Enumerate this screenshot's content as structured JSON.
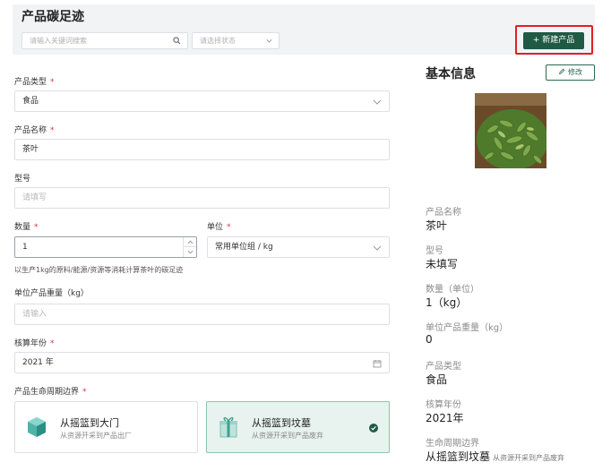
{
  "header": {
    "title": "产品碳足迹",
    "search_placeholder": "请输入关键词搜索",
    "status_placeholder": "请选择状态",
    "new_button": "+ 新建产品"
  },
  "form": {
    "product_type": {
      "label": "产品类型",
      "value": "食品"
    },
    "product_name": {
      "label": "产品名称",
      "value": "茶叶"
    },
    "model": {
      "label": "型号",
      "placeholder": "请填写"
    },
    "quantity": {
      "label": "数量",
      "value": "1"
    },
    "unit": {
      "label": "单位",
      "value": "常用单位组 / kg"
    },
    "hint": "以生产1kg的原料/能源/资源等消耗计算茶叶的碳足迹",
    "unit_weight": {
      "label": "单位产品重量（kg）",
      "placeholder": "请输入"
    },
    "year": {
      "label": "核算年份",
      "value": "2021 年"
    },
    "lifecycle": {
      "label": "产品生命周期边界",
      "options": [
        {
          "title": "从摇篮到大门",
          "subtitle": "从资源开采到产品出厂",
          "selected": false
        },
        {
          "title": "从摇篮到坟墓",
          "subtitle": "从资源开采到产品废弃",
          "selected": true
        }
      ]
    }
  },
  "info": {
    "title": "基本信息",
    "edit_button": "修改",
    "name_label": "产品名称",
    "name_value": "茶叶",
    "model_label": "型号",
    "model_value": "未填写",
    "quantity_label": "数量（单位）",
    "quantity_value": "1（kg）",
    "weight_label": "单位产品重量（kg）",
    "weight_value": "0",
    "type_label": "产品类型",
    "type_value": "食品",
    "year_label": "核算年份",
    "year_value": "2021年",
    "lifecycle_label": "生命周期边界",
    "lifecycle_value": "从摇篮到坟墓",
    "lifecycle_sub": "从资源开采到产品废弃"
  },
  "colors": {
    "primary": "#1f5a44",
    "highlight": "#e02020",
    "required": "#d9363e",
    "selected_bg": "#e8f3ef"
  }
}
